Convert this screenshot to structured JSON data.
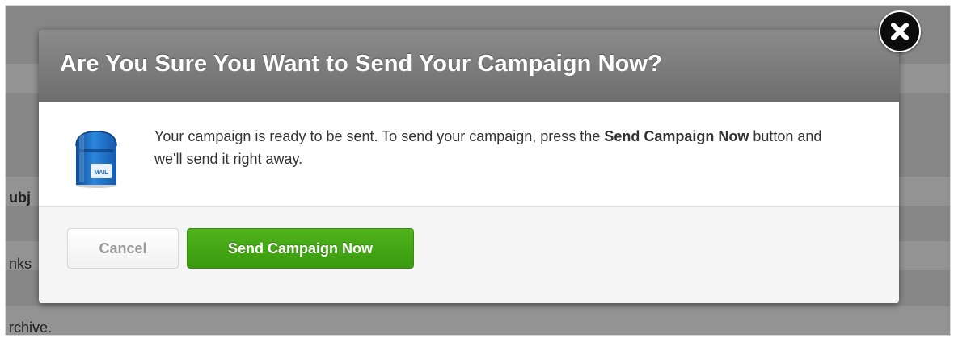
{
  "background": {
    "fragments": [
      {
        "text": "ubj",
        "bold": true
      },
      {
        "text": "nks",
        "bold": false
      },
      {
        "text": "rchive.",
        "bold": false
      }
    ]
  },
  "modal": {
    "title": "Are You Sure You Want to Send Your Campaign Now?",
    "icon": "mailbox-icon",
    "message": {
      "part1": "Your campaign is ready to be sent. To send your campaign, press the ",
      "bold": "Send Campaign Now",
      "part2": " button and we'll send it right away."
    },
    "mailbox_label": "MAIL",
    "buttons": {
      "cancel_label": "Cancel",
      "send_label": "Send Campaign Now"
    },
    "close_icon": "close-icon"
  },
  "colors": {
    "header_gradient_top": "#8b8b8b",
    "header_gradient_bottom": "#6e6e6e",
    "send_button": "#44a616",
    "mailbox_blue": "#1f6fc4",
    "overlay": "#868686"
  }
}
